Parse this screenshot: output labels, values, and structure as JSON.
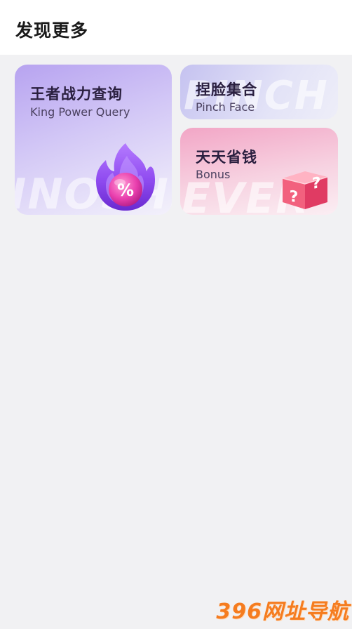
{
  "header": {
    "title": "发现更多"
  },
  "cards": [
    {
      "title": "王者战力查询",
      "subtitle": "King Power Query",
      "watermark": "INOSHEVEN",
      "icon": "flame-percent-icon",
      "gradient": [
        "#b7a3f0",
        "#f3f1fb"
      ]
    },
    {
      "title": "捏脸集合",
      "subtitle": "Pinch Face",
      "watermark": "PINCH",
      "gradient": [
        "#c5c2f0",
        "#eeeef8"
      ]
    },
    {
      "title": "天天省钱",
      "subtitle": "Bonus",
      "watermark": "EVER",
      "icon": "mystery-box-icon",
      "gradient": [
        "#f2a6c6",
        "#fbeef3"
      ]
    }
  ],
  "footer": {
    "watermark": "396网址导航"
  },
  "colors": {
    "background": "#f1f1f3",
    "header_bg": "#ffffff",
    "title_text": "#1a1a1a",
    "watermark_orange": "#f57c1f"
  }
}
